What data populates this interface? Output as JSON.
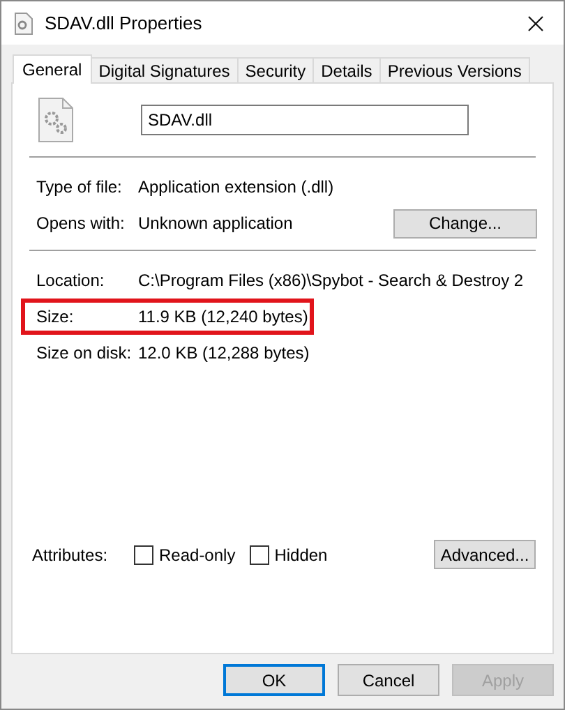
{
  "window": {
    "title": "SDAV.dll Properties"
  },
  "tabs": [
    {
      "label": "General",
      "selected": true
    },
    {
      "label": "Digital Signatures",
      "selected": false
    },
    {
      "label": "Security",
      "selected": false
    },
    {
      "label": "Details",
      "selected": false
    },
    {
      "label": "Previous Versions",
      "selected": false
    }
  ],
  "file_name": {
    "value": "SDAV.dll"
  },
  "sections": [
    {
      "rows": [
        {
          "label": "Type of file:",
          "value": "Application extension (.dll)",
          "highlighted": false
        },
        {
          "label": "Opens with:",
          "value": "Unknown application",
          "button": "Change...",
          "highlighted": false
        }
      ]
    },
    {
      "rows": [
        {
          "label": "Location:",
          "value": "C:\\Program Files (x86)\\Spybot - Search & Destroy 2",
          "highlighted": false
        },
        {
          "label": "Size:",
          "value": "11.9 KB (12,240 bytes)",
          "highlighted": true
        },
        {
          "label": "Size on disk:",
          "value": "12.0 KB (12,288 bytes)",
          "highlighted": false
        }
      ]
    }
  ],
  "attributes": {
    "label": "Attributes:",
    "checkboxes": [
      {
        "label": "Read-only",
        "checked": false
      },
      {
        "label": "Hidden",
        "checked": false
      }
    ],
    "button": "Advanced..."
  },
  "buttons": [
    {
      "label": "OK",
      "default": true,
      "disabled": false
    },
    {
      "label": "Cancel",
      "default": false,
      "disabled": false
    },
    {
      "label": "Apply",
      "default": false,
      "disabled": true
    }
  ]
}
